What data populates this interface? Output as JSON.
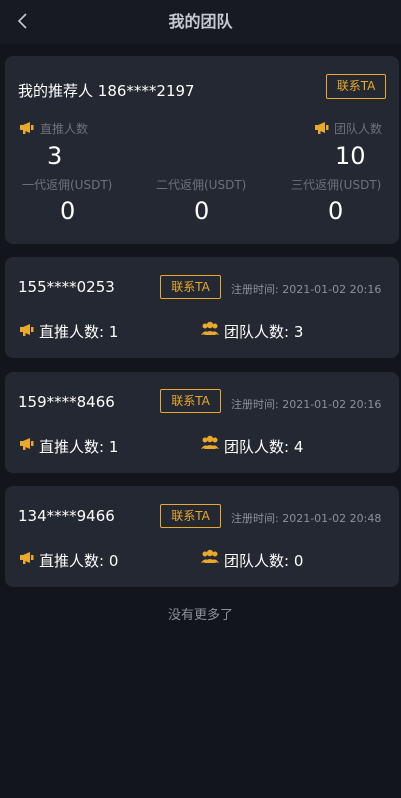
{
  "header": {
    "title": "我的团队",
    "back_icon": "chevron-left-icon"
  },
  "referrer": {
    "label": "我的推荐人",
    "phone": "186****2197",
    "contact_label": "联系TA",
    "direct_label": "直推人数",
    "direct_value": "3",
    "team_label": "团队人数",
    "team_value": "10",
    "commissions": [
      {
        "label": "一代返佣(USDT)",
        "value": "0"
      },
      {
        "label": "二代返佣(USDT)",
        "value": "0"
      },
      {
        "label": "三代返佣(USDT)",
        "value": "0"
      }
    ]
  },
  "members": [
    {
      "phone": "155****0253",
      "contact_label": "联系TA",
      "reg_label": "注册时间:",
      "reg_time": "2021-01-02 20:16",
      "direct_label": "直推人数:",
      "direct_value": "1",
      "team_label": "团队人数:",
      "team_value": "3"
    },
    {
      "phone": "159****8466",
      "contact_label": "联系TA",
      "reg_label": "注册时间:",
      "reg_time": "2021-01-02 20:16",
      "direct_label": "直推人数:",
      "direct_value": "1",
      "team_label": "团队人数:",
      "team_value": "4"
    },
    {
      "phone": "134****9466",
      "contact_label": "联系TA",
      "reg_label": "注册时间:",
      "reg_time": "2021-01-02 20:48",
      "direct_label": "直推人数:",
      "direct_value": "0",
      "team_label": "团队人数:",
      "team_value": "0"
    }
  ],
  "footer": {
    "no_more": "没有更多了"
  },
  "colors": {
    "background": "#13151c",
    "card": "#242832",
    "accent": "#e9a92b",
    "muted": "#6d717b"
  }
}
